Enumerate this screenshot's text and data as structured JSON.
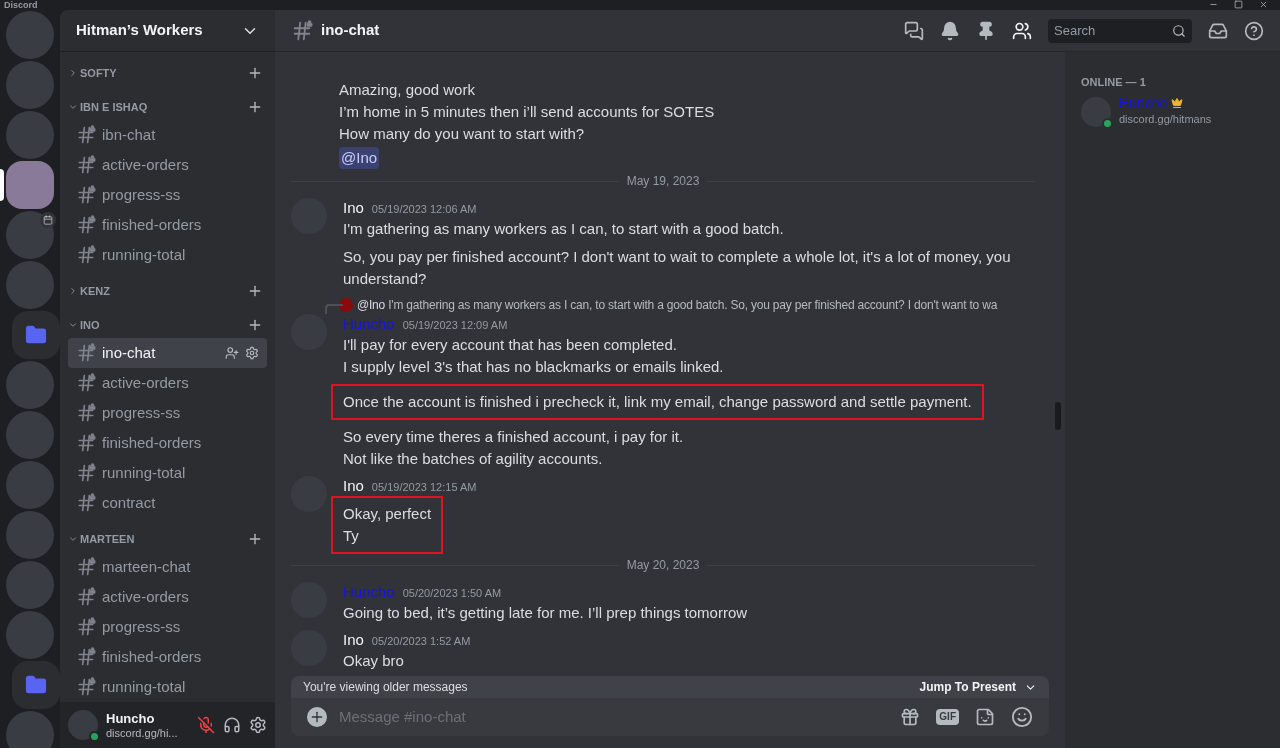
{
  "window": {
    "title": "Discord"
  },
  "servers": [
    {
      "kind": "server",
      "selected": false,
      "badge": false
    },
    {
      "kind": "server",
      "selected": false,
      "badge": false
    },
    {
      "kind": "server",
      "selected": false,
      "badge": false
    },
    {
      "kind": "server",
      "selected": true,
      "badge": false
    },
    {
      "kind": "server",
      "selected": false,
      "badge": true
    },
    {
      "kind": "server",
      "selected": false,
      "badge": false
    },
    {
      "kind": "folder"
    },
    {
      "kind": "server",
      "selected": false,
      "badge": false
    },
    {
      "kind": "server",
      "selected": false,
      "badge": false
    },
    {
      "kind": "server",
      "selected": false,
      "badge": false
    },
    {
      "kind": "server",
      "selected": false,
      "badge": false
    },
    {
      "kind": "server",
      "selected": false,
      "badge": false
    },
    {
      "kind": "server",
      "selected": false,
      "badge": false
    },
    {
      "kind": "folder"
    },
    {
      "kind": "server",
      "selected": false,
      "badge": false
    }
  ],
  "guild": {
    "name": "Hitman’s Workers"
  },
  "categories": [
    {
      "name": "SOFTY",
      "expanded": false
    },
    {
      "name": "IBN E ISHAQ",
      "expanded": true,
      "channels": [
        {
          "name": "ibn-chat",
          "selected": false
        },
        {
          "name": "active-orders",
          "selected": false
        },
        {
          "name": "progress-ss",
          "selected": false
        },
        {
          "name": "finished-orders",
          "selected": false
        },
        {
          "name": "running-total",
          "selected": false
        }
      ]
    },
    {
      "name": "KENZ",
      "expanded": false
    },
    {
      "name": "INO",
      "expanded": true,
      "channels": [
        {
          "name": "ino-chat",
          "selected": true
        },
        {
          "name": "active-orders",
          "selected": false
        },
        {
          "name": "progress-ss",
          "selected": false
        },
        {
          "name": "finished-orders",
          "selected": false
        },
        {
          "name": "running-total",
          "selected": false
        },
        {
          "name": "contract",
          "selected": false
        }
      ]
    },
    {
      "name": "MARTEEN",
      "expanded": true,
      "channels": [
        {
          "name": "marteen-chat",
          "selected": false
        },
        {
          "name": "active-orders",
          "selected": false
        },
        {
          "name": "progress-ss",
          "selected": false
        },
        {
          "name": "finished-orders",
          "selected": false
        },
        {
          "name": "running-total",
          "selected": false
        }
      ]
    }
  ],
  "user_panel": {
    "name": "Huncho",
    "status": "discord.gg/hi...",
    "muted": true
  },
  "channel_header": {
    "name": "ino-chat",
    "search_placeholder": "Search"
  },
  "messages": [
    {
      "kind": "continuation",
      "blocks": [
        {
          "highlighted": false,
          "lines": [
            "Amazing, good work",
            "I’m home in 5 minutes then i’ll send accounts for SOTES",
            "How many do you want to start with?"
          ]
        }
      ],
      "mention": "@Ino"
    },
    {
      "kind": "divider",
      "text": "May 19, 2023"
    },
    {
      "kind": "message",
      "author": "Ino",
      "color": "#f2f3f5",
      "time": "05/19/2023 12:06 AM",
      "blocks": [
        {
          "highlighted": false,
          "lines": [
            "I'm gathering as many workers as I can, to start with a good batch."
          ]
        },
        {
          "highlighted": false,
          "lines": [
            "So, you pay per finished account? I don't want to wait to complete a whole lot, it's a lot of money, you understand?"
          ]
        }
      ]
    },
    {
      "kind": "message",
      "author": "Huncho",
      "color": "#1414e6",
      "time": "05/19/2023 12:09 AM",
      "reply": {
        "author": "@Ino",
        "text": "I'm gathering as many workers as I can, to start with a good batch. So, you pay per finished account? I don't want to wa"
      },
      "blocks": [
        {
          "highlighted": false,
          "lines": [
            "I'll pay for every account that has been completed.",
            "I supply level 3's that has no blackmarks or emails linked."
          ]
        },
        {
          "highlighted": true,
          "lines": [
            "Once the account is finished i precheck it, link my email, change password and settle payment."
          ]
        },
        {
          "highlighted": false,
          "lines": [
            "So every time theres a finished account, i pay for it.",
            "Not like the batches of agility accounts."
          ]
        }
      ]
    },
    {
      "kind": "message",
      "author": "Ino",
      "color": "#f2f3f5",
      "time": "05/19/2023 12:15 AM",
      "blocks": [
        {
          "highlighted": true,
          "lines": [
            "Okay, perfect",
            "Ty"
          ]
        }
      ]
    },
    {
      "kind": "divider",
      "text": "May 20, 2023"
    },
    {
      "kind": "message",
      "author": "Huncho",
      "color": "#1414e6",
      "time": "05/20/2023 1:50 AM",
      "blocks": [
        {
          "highlighted": false,
          "lines": [
            "Going to bed, it’s getting late for me. I’ll prep things tomorrow"
          ]
        }
      ]
    },
    {
      "kind": "message",
      "author": "Ino",
      "color": "#f2f3f5",
      "time": "05/20/2023 1:52 AM",
      "blocks": [
        {
          "highlighted": false,
          "lines": [
            "Okay bro"
          ]
        }
      ]
    }
  ],
  "older_bar": {
    "text": "You're viewing older messages",
    "button": "Jump To Present"
  },
  "composer": {
    "placeholder": "Message #ino-chat",
    "gif": "GIF"
  },
  "members": {
    "heading": "ONLINE — 1",
    "list": [
      {
        "name": "Huncho",
        "color": "#1414e6",
        "status": "discord.gg/hitmans",
        "owner": true
      }
    ]
  }
}
